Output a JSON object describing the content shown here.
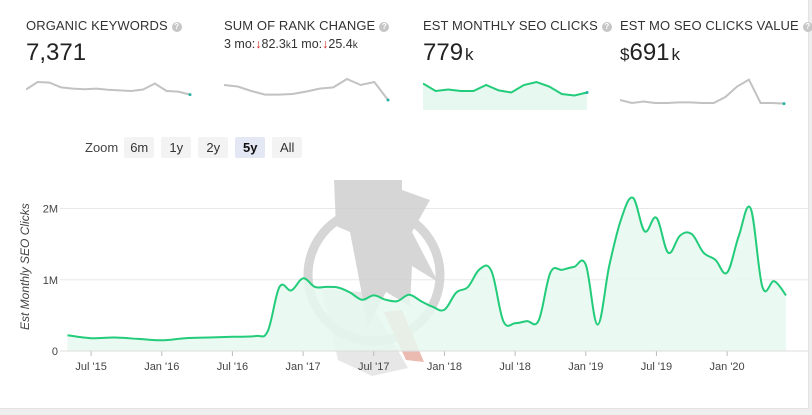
{
  "metrics": [
    {
      "label": "ORGANIC KEYWORDS",
      "value": "7,371",
      "unit": "",
      "currency": "",
      "sub": null
    },
    {
      "label": "SUM OF RANK CHANGE",
      "value": "",
      "unit": "",
      "currency": "",
      "sub": {
        "p1_label": "3 mo:",
        "p1_arrow": "↓",
        "p1_value": "82.3",
        "p1_unit": "k",
        "p2_label": "1 mo:",
        "p2_arrow": "↓",
        "p2_value": "25.4",
        "p2_unit": "k"
      }
    },
    {
      "label": "EST MONTHLY SEO CLICKS",
      "value": "779",
      "unit": "k",
      "currency": "",
      "sub": null
    },
    {
      "label": "EST MO SEO CLICKS VALUE",
      "value": "691",
      "unit": "k",
      "currency": "$",
      "sub": null
    }
  ],
  "help_glyph": "?",
  "zoom": {
    "label": "Zoom",
    "options": [
      "6m",
      "1y",
      "2y",
      "5y",
      "All"
    ],
    "active": "5y"
  },
  "colors": {
    "accent": "#22cc7a",
    "accent_fill": "#e6f8ef",
    "spark_gray": "#c2c2c2",
    "spark_end": "#27b3a0",
    "grid": "#e8e8e8",
    "watermark": "#cfcfcf",
    "watermark_red": "#e8b0a5"
  },
  "chart_data": {
    "type": "area",
    "ylabel": "Est Monthly SEO Clicks",
    "y_ticks": [
      "0",
      "1M",
      "2M"
    ],
    "ylim": [
      0,
      2400000
    ],
    "x_ticks": [
      "Jul '15",
      "Jan '16",
      "Jul '16",
      "Jan '17",
      "Jul '17",
      "Jan '18",
      "Jul '18",
      "Jan '19",
      "Jul '19",
      "Jan '20"
    ],
    "series": [
      {
        "values": [
          [
            "2015-05",
            220000
          ],
          [
            "2015-07",
            180000
          ],
          [
            "2015-09",
            190000
          ],
          [
            "2015-11",
            170000
          ],
          [
            "2016-01",
            150000
          ],
          [
            "2016-03",
            180000
          ],
          [
            "2016-05",
            190000
          ],
          [
            "2016-07",
            200000
          ],
          [
            "2016-09",
            210000
          ],
          [
            "2016-10",
            280000
          ],
          [
            "2016-11",
            900000
          ],
          [
            "2016-12",
            850000
          ],
          [
            "2017-01",
            1020000
          ],
          [
            "2017-02",
            900000
          ],
          [
            "2017-03",
            900000
          ],
          [
            "2017-04",
            890000
          ],
          [
            "2017-05",
            820000
          ],
          [
            "2017-06",
            720000
          ],
          [
            "2017-07",
            780000
          ],
          [
            "2017-08",
            720000
          ],
          [
            "2017-09",
            700000
          ],
          [
            "2017-10",
            790000
          ],
          [
            "2017-11",
            700000
          ],
          [
            "2017-12",
            620000
          ],
          [
            "2018-01",
            580000
          ],
          [
            "2018-02",
            820000
          ],
          [
            "2018-03",
            900000
          ],
          [
            "2018-04",
            1150000
          ],
          [
            "2018-05",
            1120000
          ],
          [
            "2018-06",
            420000
          ],
          [
            "2018-07",
            390000
          ],
          [
            "2018-08",
            420000
          ],
          [
            "2018-09",
            430000
          ],
          [
            "2018-10",
            1100000
          ],
          [
            "2018-11",
            1140000
          ],
          [
            "2018-12",
            1180000
          ],
          [
            "2019-01",
            1210000
          ],
          [
            "2019-02",
            370000
          ],
          [
            "2019-03",
            1200000
          ],
          [
            "2019-04",
            1850000
          ],
          [
            "2019-05",
            2150000
          ],
          [
            "2019-06",
            1680000
          ],
          [
            "2019-07",
            1870000
          ],
          [
            "2019-08",
            1380000
          ],
          [
            "2019-09",
            1620000
          ],
          [
            "2019-10",
            1640000
          ],
          [
            "2019-11",
            1380000
          ],
          [
            "2019-12",
            1280000
          ],
          [
            "2020-01",
            1100000
          ],
          [
            "2020-02",
            1620000
          ],
          [
            "2020-03",
            2000000
          ],
          [
            "2020-04",
            900000
          ],
          [
            "2020-05",
            980000
          ],
          [
            "2020-06",
            780000
          ]
        ]
      }
    ],
    "grid": true,
    "legend": "none"
  },
  "sparklines": [
    {
      "values": [
        0.45,
        0.2,
        0.22,
        0.38,
        0.42,
        0.44,
        0.42,
        0.46,
        0.48,
        0.5,
        0.45,
        0.25,
        0.5,
        0.52,
        0.62
      ],
      "filled": false
    },
    {
      "values": [
        0.3,
        0.35,
        0.5,
        0.62,
        0.62,
        0.6,
        0.52,
        0.42,
        0.38,
        0.1,
        0.3,
        0.2,
        0.8
      ],
      "filled": false
    },
    {
      "values": [
        0.25,
        0.5,
        0.45,
        0.5,
        0.5,
        0.3,
        0.48,
        0.55,
        0.3,
        0.2,
        0.35,
        0.6,
        0.65,
        0.55
      ],
      "filled": true
    },
    {
      "values": [
        0.8,
        0.9,
        0.85,
        0.9,
        0.9,
        0.88,
        0.88,
        0.9,
        0.9,
        0.7,
        0.35,
        0.12,
        0.9,
        0.9,
        0.92
      ],
      "filled": false
    }
  ]
}
